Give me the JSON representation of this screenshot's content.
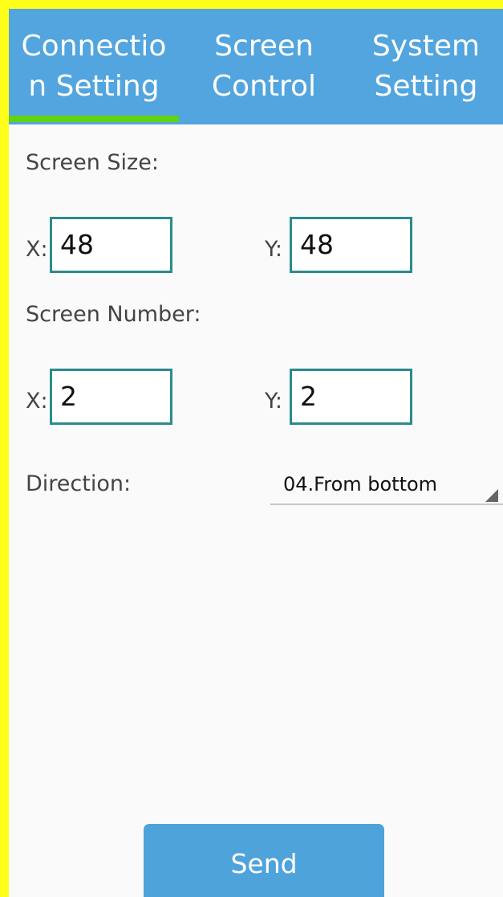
{
  "tabs": [
    {
      "label_line1": "Connectio",
      "label_line2": "n Setting"
    },
    {
      "label_line1": "Screen",
      "label_line2": "Control"
    },
    {
      "label_line1": "System",
      "label_line2": "Setting"
    }
  ],
  "screen_size": {
    "label": "Screen Size:",
    "x_label": "X:",
    "x_value": "48",
    "y_label": "Y:",
    "y_value": "48"
  },
  "screen_number": {
    "label": "Screen Number:",
    "x_label": "X:",
    "x_value": "2",
    "y_label": "Y:",
    "y_value": "2"
  },
  "direction": {
    "label": "Direction:",
    "selected": "04.From bottom"
  },
  "send_label": "Send",
  "colors": {
    "tab_bar": "#52a5de",
    "tab_indicator": "#5fd314",
    "input_border": "#2b8c8b",
    "button": "#4fa3db",
    "outer_border": "#ffff1a"
  }
}
